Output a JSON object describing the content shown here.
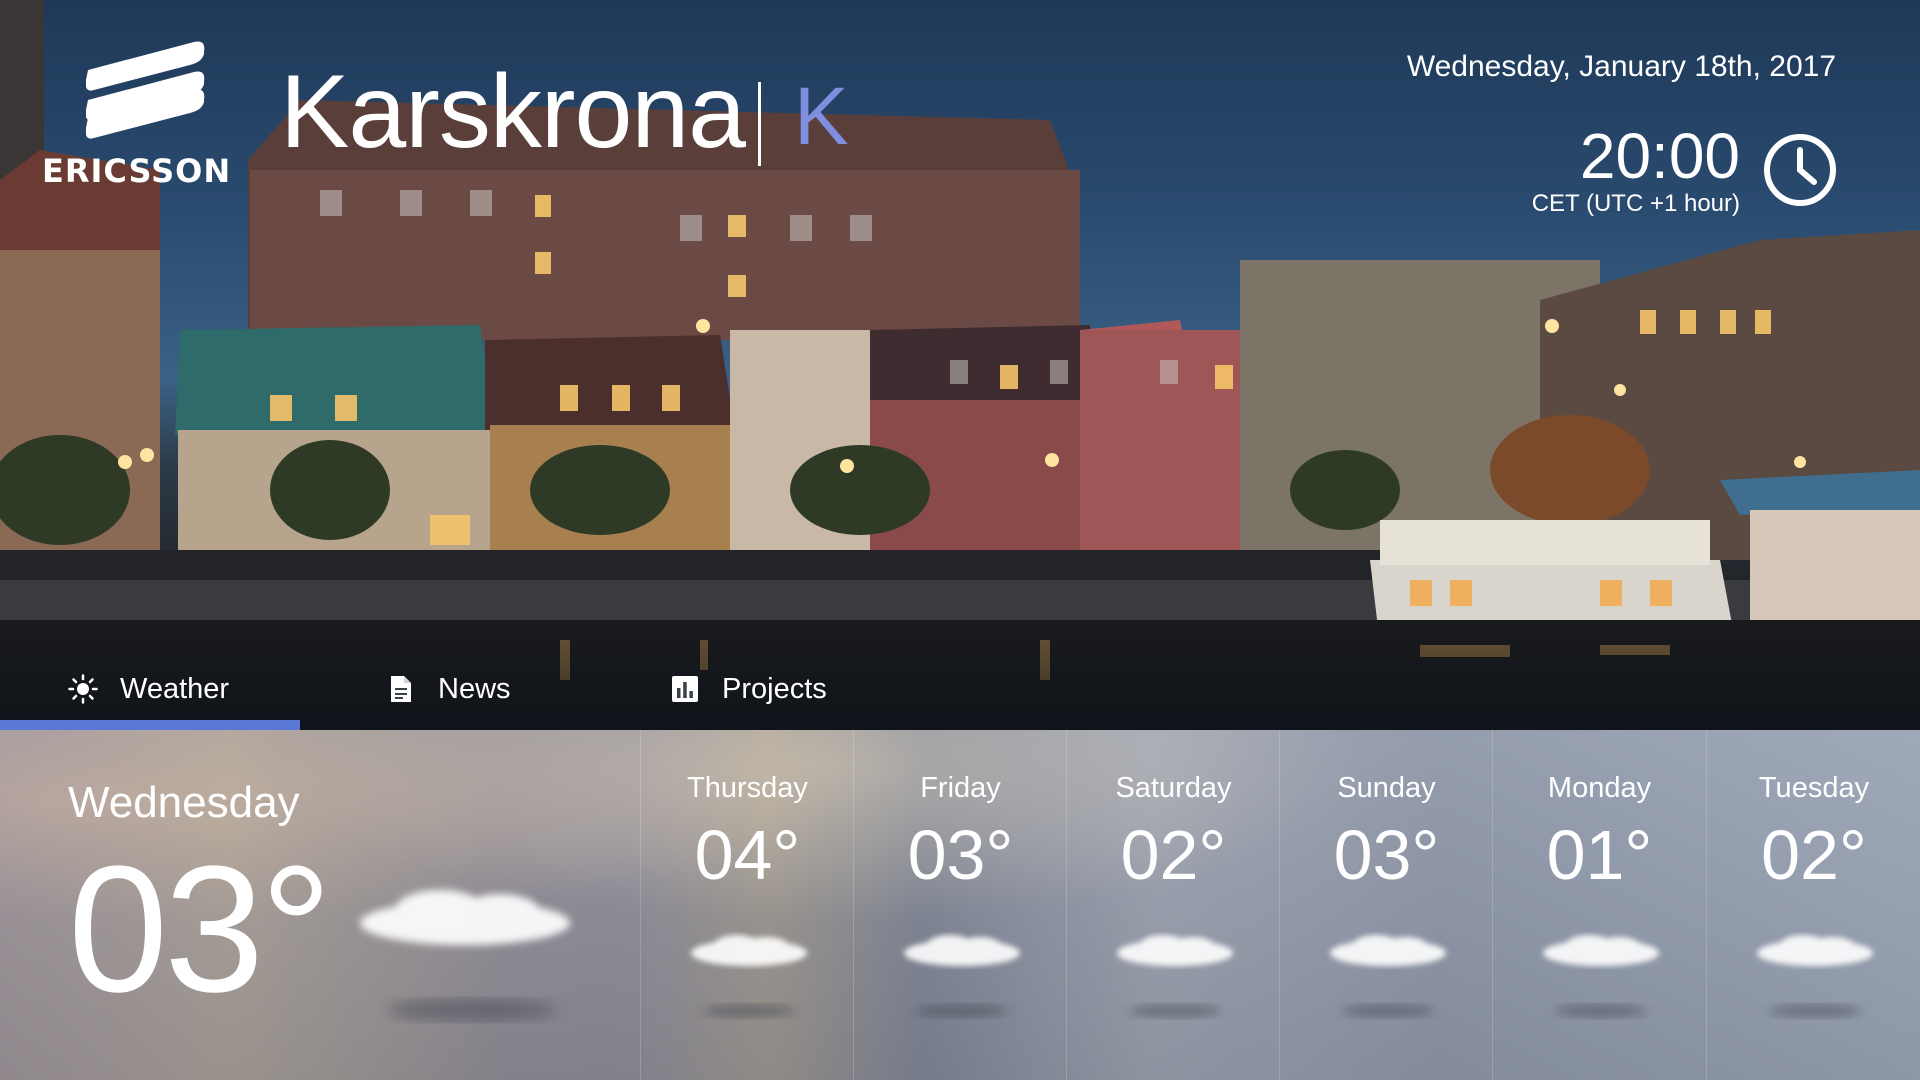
{
  "header": {
    "brand": "ERICSSON",
    "city": "Karskrona",
    "city_letter": "K",
    "date": "Wednesday, January 18th, 2017",
    "time": "20:00",
    "timezone": "CET (UTC +1 hour)"
  },
  "tabs": [
    {
      "label": "Weather",
      "icon": "sun-icon",
      "active": true
    },
    {
      "label": "News",
      "icon": "document-icon",
      "active": false
    },
    {
      "label": "Projects",
      "icon": "bar-chart-icon",
      "active": false
    }
  ],
  "colors": {
    "accent": "#5b78d6",
    "city_letter": "#7f8fe0"
  },
  "weather": {
    "today": {
      "day": "Wednesday",
      "temp": "03°",
      "icon": "cloud-icon"
    },
    "forecast": [
      {
        "day": "Thursday",
        "temp": "04°",
        "icon": "cloud-icon"
      },
      {
        "day": "Friday",
        "temp": "03°",
        "icon": "cloud-icon"
      },
      {
        "day": "Saturday",
        "temp": "02°",
        "icon": "cloud-icon"
      },
      {
        "day": "Sunday",
        "temp": "03°",
        "icon": "cloud-icon"
      },
      {
        "day": "Monday",
        "temp": "01°",
        "icon": "cloud-icon"
      },
      {
        "day": "Tuesday",
        "temp": "02°",
        "icon": "cloud-icon"
      }
    ]
  }
}
